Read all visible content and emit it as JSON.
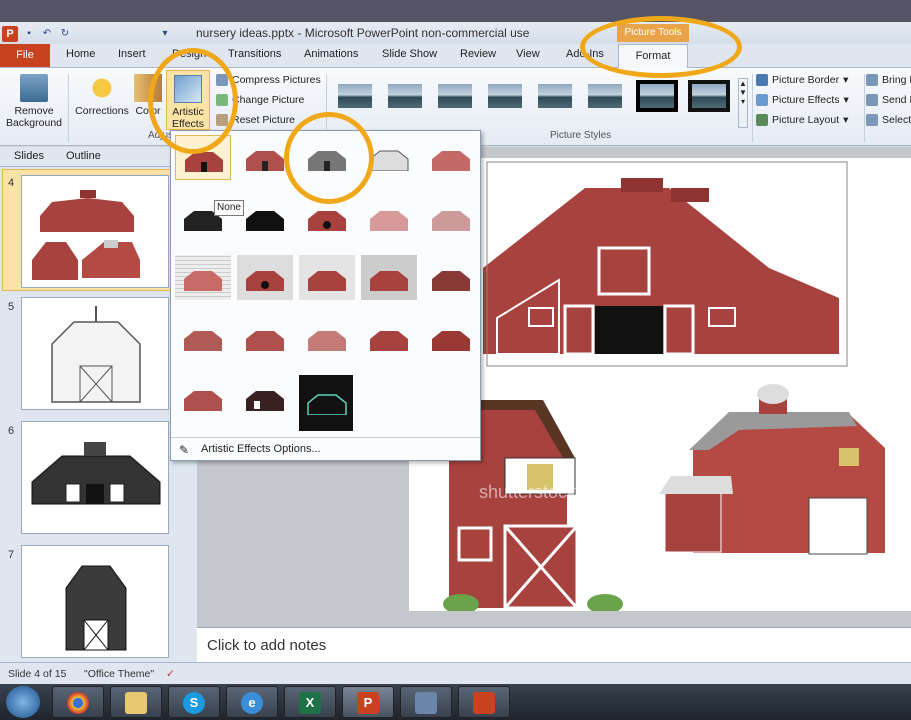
{
  "window": {
    "title": "nursery ideas.pptx - Microsoft PowerPoint non-commercial use",
    "context_group": "Picture Tools"
  },
  "tabs": [
    "File",
    "Home",
    "Insert",
    "Design",
    "Transitions",
    "Animations",
    "Slide Show",
    "Review",
    "View",
    "Add-Ins",
    "Format"
  ],
  "ribbon": {
    "remove_background": "Remove Background",
    "corrections": "Corrections",
    "color": "Color",
    "artistic_effects": "Artistic Effects",
    "compress_pictures": "Compress Pictures",
    "change_picture": "Change Picture",
    "reset_picture": "Reset Picture",
    "picture_styles_label": "Picture Styles",
    "adjust_label": "Adjust",
    "picture_border": "Picture Border",
    "picture_effects": "Picture Effects",
    "picture_layout": "Picture Layout",
    "bring_forward": "Bring F",
    "send_backward": "Send B",
    "selection": "Selectio"
  },
  "pane": {
    "tab_slides": "Slides",
    "tab_outline": "Outline",
    "slide_numbers": [
      "4",
      "5",
      "6",
      "7"
    ]
  },
  "gallery": {
    "tooltip": "None",
    "options": "Artistic Effects Options..."
  },
  "notes_placeholder": "Click to add notes",
  "status": {
    "slide_info": "Slide 4 of 15",
    "theme": "\"Office Theme\""
  },
  "canvas_watermark": "shutterstock",
  "colors": {
    "highlight": "#f0a818",
    "barn_red": "#a8423f",
    "file_tab": "#c8421f"
  }
}
